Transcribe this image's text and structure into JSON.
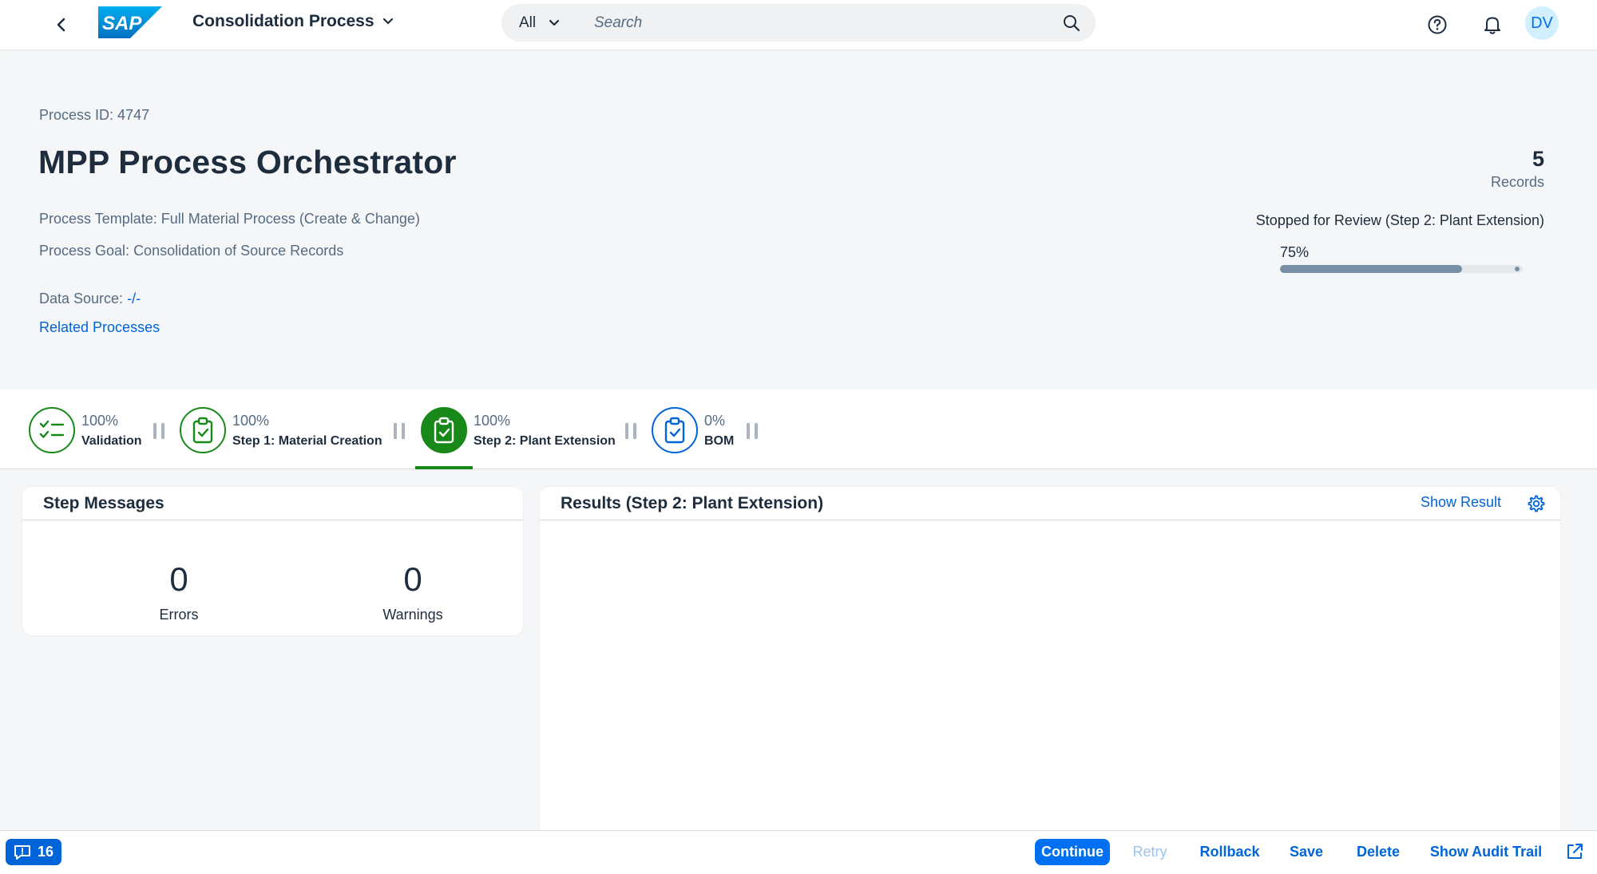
{
  "shell": {
    "app_title": "Consolidation Process",
    "search_scope": "All",
    "search_placeholder": "Search",
    "avatar_initials": "DV",
    "brand_color": "#0070f2"
  },
  "header": {
    "process_id_label": "Process ID:",
    "process_id_value": "4747",
    "title": "MPP Process Orchestrator",
    "template_label": "Process Template:",
    "template_value": "Full Material Process (Create & Change)",
    "goal_label": "Process Goal:",
    "goal_value": "Consolidation of Source Records",
    "data_source_label": "Data Source:",
    "data_source_value": "-/-",
    "related_link": "Related Processes",
    "records_count": "5",
    "records_label": "Records",
    "status": "Stopped for Review (Step 2: Plant Extension)",
    "progress_text": "75%",
    "progress_value": 0.75
  },
  "steps": [
    {
      "pct": "100%",
      "name": "Validation",
      "icon": "checklist-icon",
      "state": "completed"
    },
    {
      "pct": "100%",
      "name": "Step 1: Material Creation",
      "icon": "clipboard-check-icon",
      "state": "completed"
    },
    {
      "pct": "100%",
      "name": "Step 2: Plant Extension",
      "icon": "clipboard-check-icon",
      "state": "selected"
    },
    {
      "pct": "0%",
      "name": "BOM",
      "icon": "clipboard-check-icon",
      "state": "pending"
    }
  ],
  "step_messages": {
    "title": "Step Messages",
    "errors_count": "0",
    "errors_label": "Errors",
    "warnings_count": "0",
    "warnings_label": "Warnings"
  },
  "results": {
    "title": "Results (Step 2: Plant Extension)",
    "show_result": "Show Result"
  },
  "footer": {
    "message_count": "16",
    "continue": "Continue",
    "retry": "Retry",
    "rollback": "Rollback",
    "save": "Save",
    "delete": "Delete",
    "audit_trail": "Show Audit Trail"
  },
  "colors": {
    "success": "#188918",
    "link": "#0064d9",
    "progress": "#788fa6"
  }
}
